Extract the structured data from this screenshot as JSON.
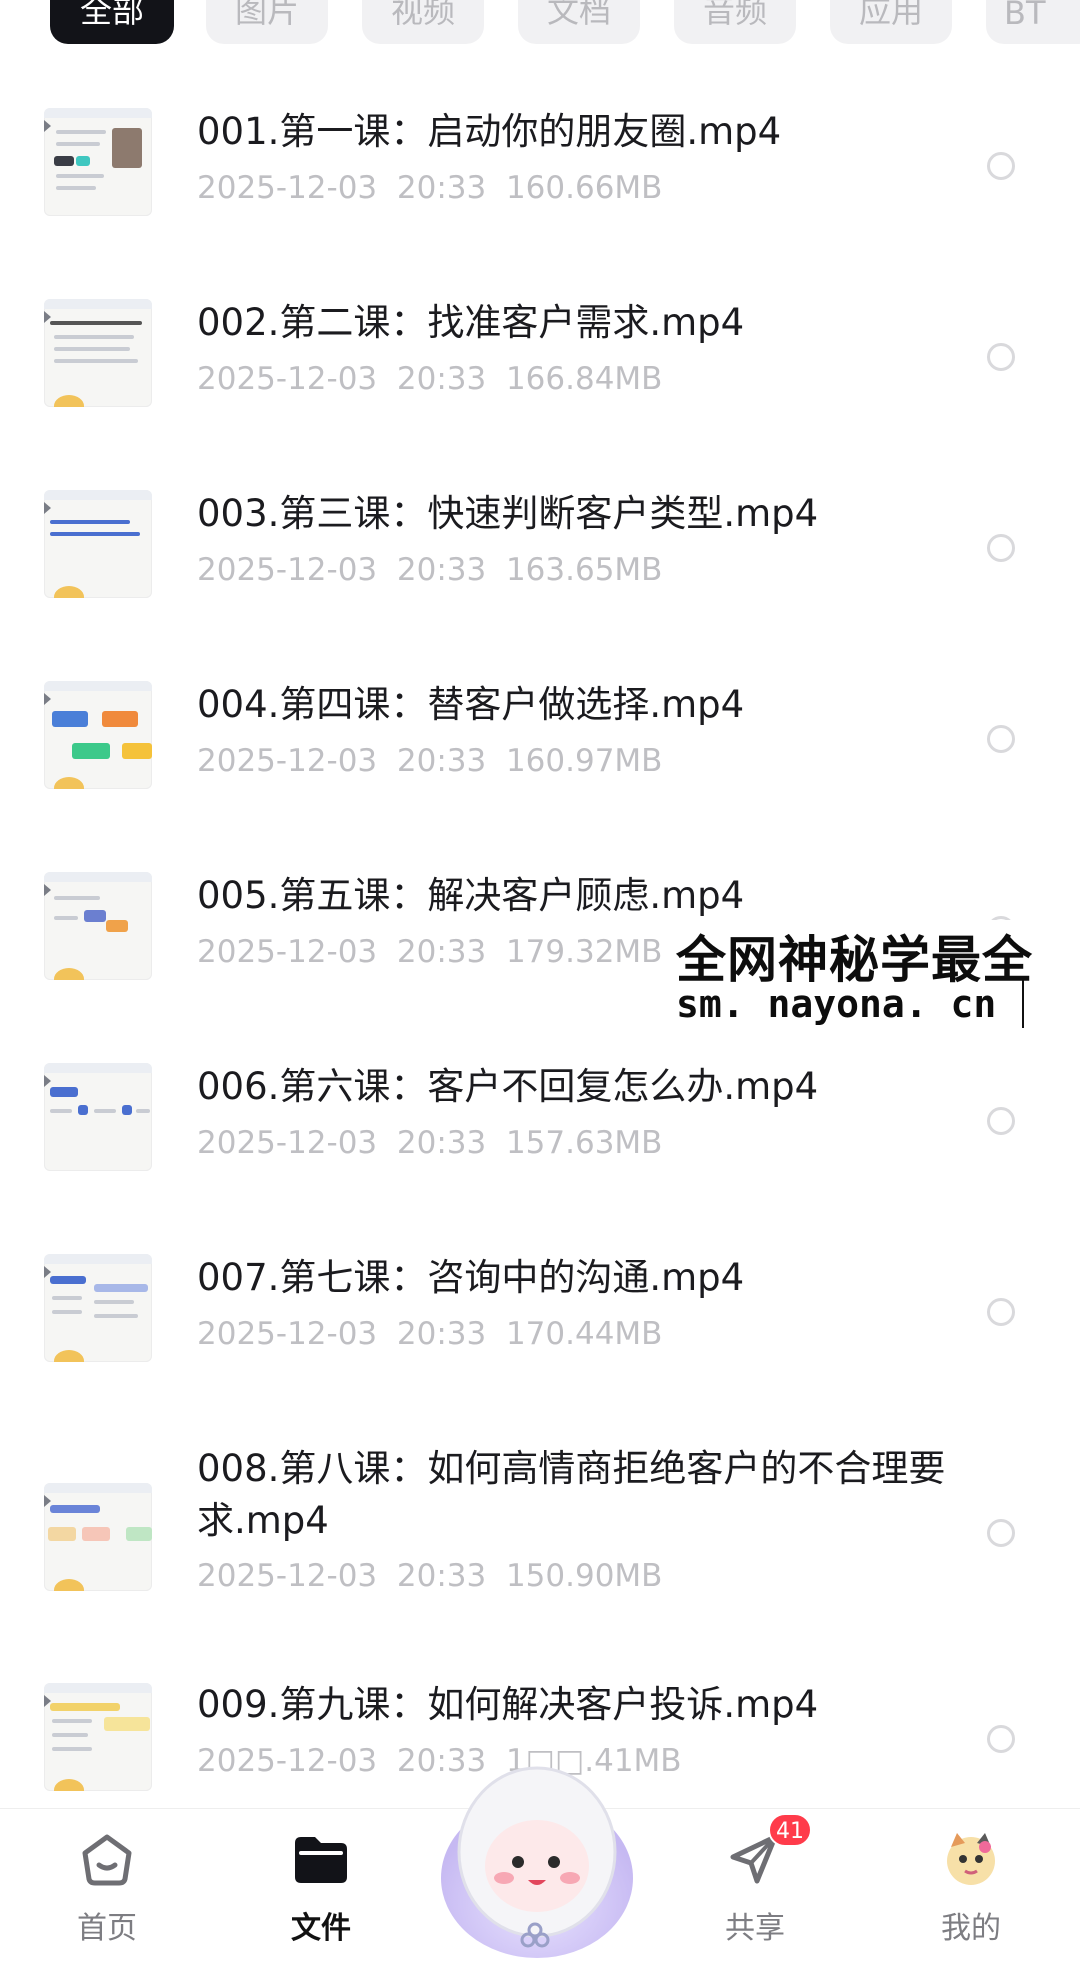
{
  "tabs": [
    {
      "label": "全部",
      "active": true
    },
    {
      "label": "图片"
    },
    {
      "label": "视频"
    },
    {
      "label": "文档"
    },
    {
      "label": "音频"
    },
    {
      "label": "应用"
    },
    {
      "label": "BT"
    }
  ],
  "files": [
    {
      "name": "001.第一课：启动你的朋友圈.mp4",
      "date": "2025-12-03",
      "time": "20:33",
      "size": "160.66MB"
    },
    {
      "name": "002.第二课：找准客户需求.mp4",
      "date": "2025-12-03",
      "time": "20:33",
      "size": "166.84MB"
    },
    {
      "name": "003.第三课：快速判断客户类型.mp4",
      "date": "2025-12-03",
      "time": "20:33",
      "size": "163.65MB"
    },
    {
      "name": "004.第四课：替客户做选择.mp4",
      "date": "2025-12-03",
      "time": "20:33",
      "size": "160.97MB"
    },
    {
      "name": "005.第五课：解决客户顾虑.mp4",
      "date": "2025-12-03",
      "time": "20:33",
      "size": "179.32MB"
    },
    {
      "name": "006.第六课：客户不回复怎么办.mp4",
      "date": "2025-12-03",
      "time": "20:33",
      "size": "157.63MB"
    },
    {
      "name": "007.第七课：咨询中的沟通.mp4",
      "date": "2025-12-03",
      "time": "20:33",
      "size": "170.44MB"
    },
    {
      "name": "008.第八课：如何高情商拒绝客户的不合理要求.mp4",
      "date": "2025-12-03",
      "time": "20:33",
      "size": "150.90MB"
    },
    {
      "name": "009.第九课：如何解决客户投诉.mp4",
      "date": "2025-12-03",
      "time": "20:33",
      "size": "1□□.41MB"
    }
  ],
  "watermark": {
    "title": "全网神秘学最全",
    "url": "sm. nayona. cn"
  },
  "bottom_nav": [
    {
      "label": "首页",
      "icon": "home-icon"
    },
    {
      "label": "文件",
      "icon": "folder-icon",
      "active": true
    },
    {
      "label": "",
      "icon": "mascot-icon"
    },
    {
      "label": "共享",
      "icon": "paper-plane-icon",
      "badge": "41"
    },
    {
      "label": "我的",
      "icon": "avatar-icon"
    }
  ],
  "colors": {
    "active_tab_bg": "#121318",
    "inactive_tab_bg": "#f1f1f3",
    "meta_text": "#bfbfc3",
    "badge": "#ff3b4a"
  }
}
